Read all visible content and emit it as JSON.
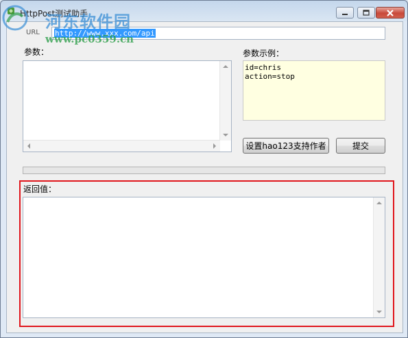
{
  "window": {
    "title": "HttpPost测试助手"
  },
  "form": {
    "url_label": "URL",
    "url_value": "http://www.xxx.com/api",
    "params_label": "参数：",
    "params_value": "",
    "example_label": "参数示例：",
    "example_lines": [
      "id=chris",
      "action=stop"
    ],
    "progress_fraction": 0,
    "return_label": "返回值：",
    "return_value": ""
  },
  "buttons": {
    "settings": "设置hao123支持作者",
    "submit": "提交"
  },
  "watermark": {
    "site_name": "河东软件园",
    "site_url": "www.pc0359.cn"
  },
  "colors": {
    "highlight": "#e0151b",
    "example_bg": "#ffffe1",
    "selection": "#3399ff"
  },
  "icons": {
    "app": "app-icon",
    "minimize": "minimize-icon",
    "maximize": "maximize-icon",
    "close": "close-icon"
  }
}
